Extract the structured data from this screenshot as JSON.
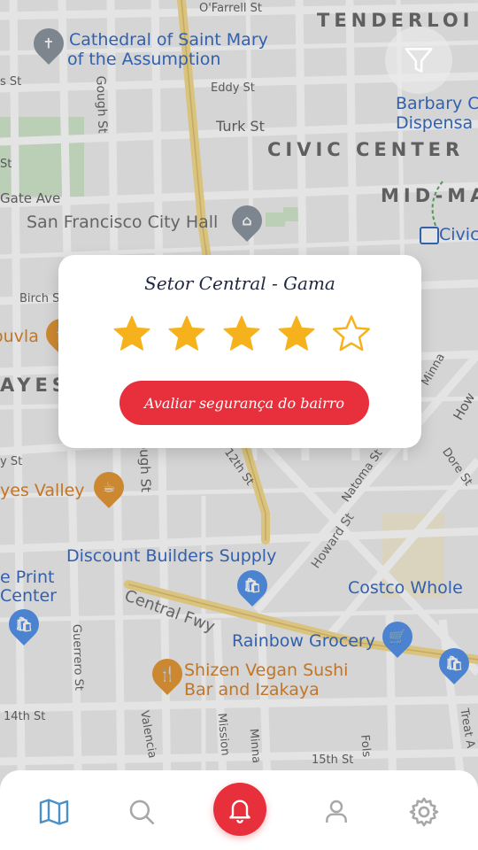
{
  "map": {
    "labels": {
      "cathedral": "Cathedral of Saint Mary",
      "cathedral2": "of the Assumption",
      "tenderloin": "TENDERLOI",
      "civic_center": "CIVIC CENTER",
      "mid_ma": "MID-MA",
      "barbary": "Barbary C",
      "dispensa": "Dispensa",
      "city_hall": "San Francisco City Hall",
      "civic_bart": "Civic",
      "hayes": "AYES",
      "uvla": "ouvla",
      "hayes_valley": "yes Valley",
      "discount": "Discount Builders Supply",
      "print": "e Print",
      "center": "Center",
      "costco": "Costco Whole",
      "rainbow": "Rainbow Grocery",
      "shizen1": "Shizen Vegan Sushi",
      "shizen2": "Bar and Izakaya",
      "central_fwy": "Central Fwy",
      "howard": "Howard St"
    },
    "streets": {
      "ofarrell": "O'Farrell St",
      "eddy": "Eddy St",
      "turk": "Turk St",
      "gough": "Gough St",
      "gate": "Gate Ave",
      "birch": "Birch St",
      "minna": "Minna",
      "howard_st": "How",
      "twelfth": "12th St",
      "natoma": "Natoma St",
      "dore": "Dore St",
      "guerrero": "Guerrero St",
      "valencia": "Valencia",
      "mission": "Mission",
      "minna2": "Minna",
      "fifteenth": "15th St",
      "fourteenth": "14th St",
      "folsom": "Fols",
      "treat": "Treat A",
      "ough": "ough St",
      "st": "St",
      "s_st": "s St",
      "st2": "y St"
    }
  },
  "modal": {
    "title": "Setor Central - Gama",
    "rating": 4,
    "max_rating": 5,
    "button_label": "Avaliar segurança do bairro"
  },
  "nav": {
    "items": [
      "map-icon",
      "search-icon",
      "bell-icon",
      "user-icon",
      "gear-icon"
    ],
    "active": "map-icon"
  },
  "colors": {
    "accent": "#e8303d",
    "star": "#f5b21d",
    "nav_active": "#4a90c8",
    "nav_inactive": "#a7a7a7"
  }
}
